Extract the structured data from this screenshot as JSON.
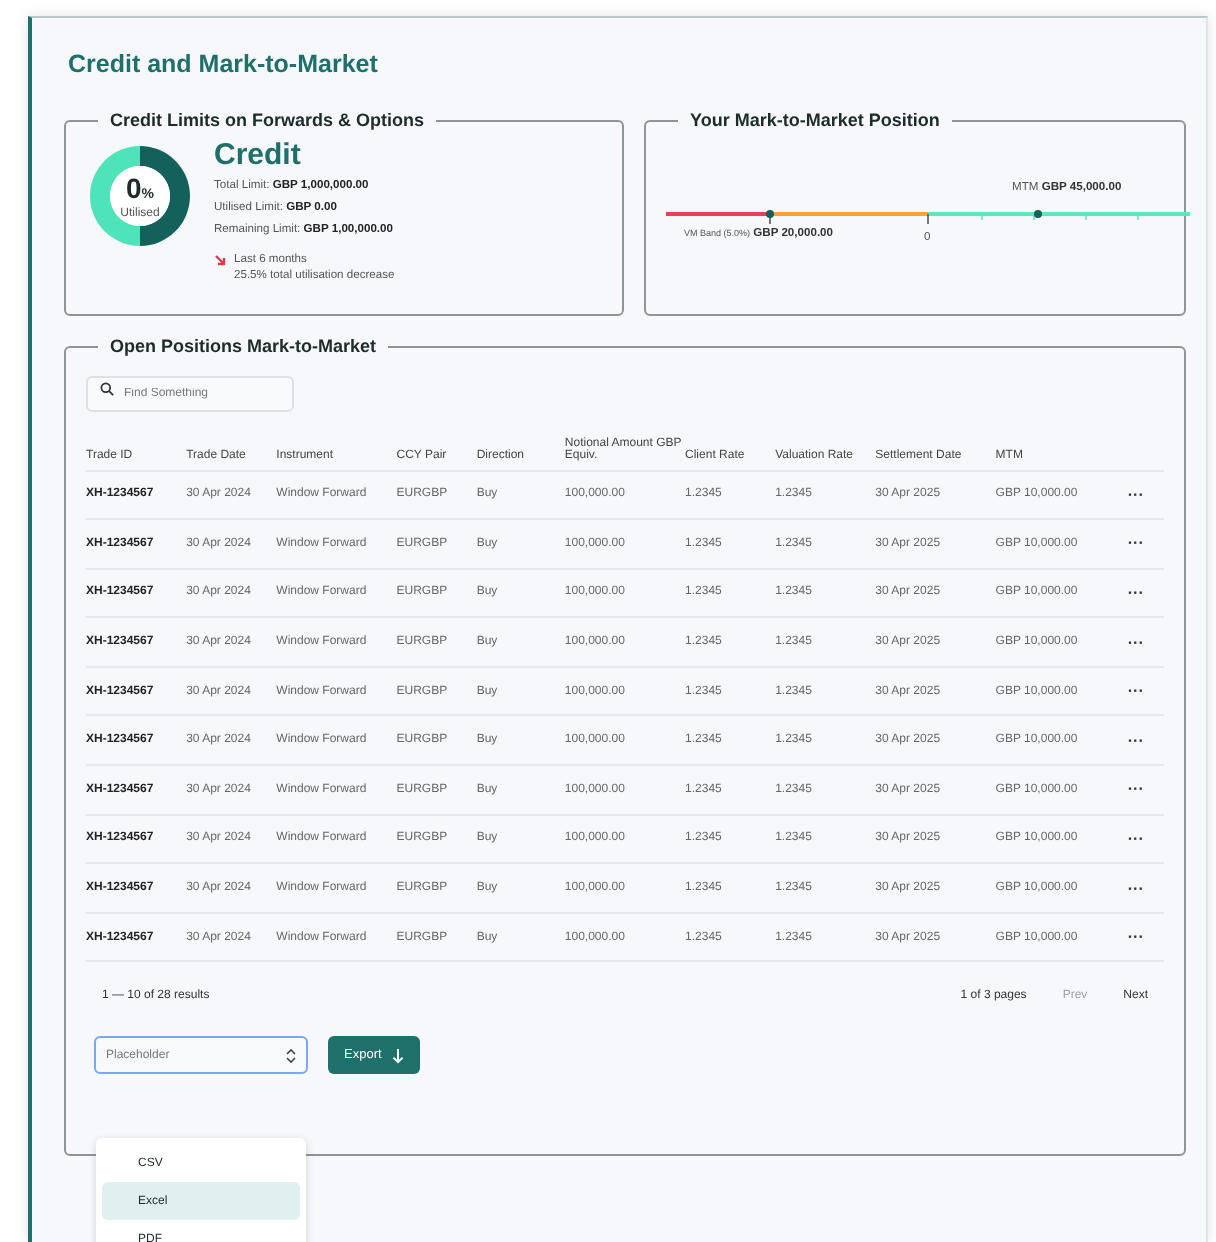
{
  "page_title": "Credit and Mark-to-Market",
  "credit_limits": {
    "legend": "Credit Limits on Forwards & Options",
    "percent": "0",
    "percent_unit": "%",
    "utilised_label": "Utilised",
    "heading": "Credit",
    "lines": [
      {
        "label": "Total Limit:",
        "value": "GBP 1,000,000.00"
      },
      {
        "label": "Utilised Limit:",
        "value": "GBP 0.00"
      },
      {
        "label": "Remaining Limit:",
        "value": "GBP 1,00,000.00"
      }
    ],
    "trend": {
      "decrease": true,
      "period": "Last 6 months",
      "note": "25.5% total utilisation decrease"
    }
  },
  "mtm_position": {
    "legend": "Your Mark-to-Market Position",
    "mtm_label": "MTM",
    "mtm_value": "GBP 45,000.00",
    "vm_label": "VM Band (5.0%)",
    "vm_value": "GBP 20,000.00",
    "zero_label": "0"
  },
  "positions": {
    "legend": "Open Positions Mark-to-Market",
    "search": {
      "placeholder": "Find Something"
    },
    "columns": [
      "Trade ID",
      "Trade Date",
      "Instrument",
      "CCY Pair",
      "Direction",
      "Notional Amount GBP Equiv.",
      "Client Rate",
      "Valuation Rate",
      "Settlement Date",
      "MTM"
    ],
    "rows": [
      {
        "cells": [
          "XH-1234567",
          "30 Apr 2024",
          "Window Forward",
          "EURGBP",
          "Buy",
          "100,000.00",
          "1.2345",
          "1.2345",
          "30 Apr 2025",
          "GBP 10,000.00"
        ],
        "menu": "···"
      },
      {
        "cells": [
          "XH-1234567",
          "30 Apr 2024",
          "Window Forward",
          "EURGBP",
          "Buy",
          "100,000.00",
          "1.2345",
          "1.2345",
          "30 Apr 2025",
          "GBP 10,000.00"
        ],
        "menu": "···"
      },
      {
        "cells": [
          "XH-1234567",
          "30 Apr 2024",
          "Window Forward",
          "EURGBP",
          "Buy",
          "100,000.00",
          "1.2345",
          "1.2345",
          "30 Apr 2025",
          "GBP 10,000.00"
        ],
        "menu": "···"
      },
      {
        "cells": [
          "XH-1234567",
          "30 Apr 2024",
          "Window Forward",
          "EURGBP",
          "Buy",
          "100,000.00",
          "1.2345",
          "1.2345",
          "30 Apr 2025",
          "GBP 10,000.00"
        ],
        "menu": "···"
      },
      {
        "cells": [
          "XH-1234567",
          "30 Apr 2024",
          "Window Forward",
          "EURGBP",
          "Buy",
          "100,000.00",
          "1.2345",
          "1.2345",
          "30 Apr 2025",
          "GBP 10,000.00"
        ],
        "menu": "···"
      },
      {
        "cells": [
          "XH-1234567",
          "30 Apr 2024",
          "Window Forward",
          "EURGBP",
          "Buy",
          "100,000.00",
          "1.2345",
          "1.2345",
          "30 Apr 2025",
          "GBP 10,000.00"
        ],
        "menu": "···"
      },
      {
        "cells": [
          "XH-1234567",
          "30 Apr 2024",
          "Window Forward",
          "EURGBP",
          "Buy",
          "100,000.00",
          "1.2345",
          "1.2345",
          "30 Apr 2025",
          "GBP 10,000.00"
        ],
        "menu": "···"
      },
      {
        "cells": [
          "XH-1234567",
          "30 Apr 2024",
          "Window Forward",
          "EURGBP",
          "Buy",
          "100,000.00",
          "1.2345",
          "1.2345",
          "30 Apr 2025",
          "GBP 10,000.00"
        ],
        "menu": "···"
      },
      {
        "cells": [
          "XH-1234567",
          "30 Apr 2024",
          "Window Forward",
          "EURGBP",
          "Buy",
          "100,000.00",
          "1.2345",
          "1.2345",
          "30 Apr 2025",
          "GBP 10,000.00"
        ],
        "menu": "···"
      },
      {
        "cells": [
          "XH-1234567",
          "30 Apr 2024",
          "Window Forward",
          "EURGBP",
          "Buy",
          "100,000.00",
          "1.2345",
          "1.2345",
          "30 Apr 2025",
          "GBP 10,000.00"
        ],
        "menu": "···"
      }
    ],
    "results": "1 — 10 of 28 results",
    "pages": "1 of 3 pages",
    "pager": [
      {
        "label": "Prev",
        "disabled": true
      },
      {
        "label": "Next",
        "disabled": false
      }
    ],
    "export_select": {
      "placeholder": "Placeholder",
      "expanded": true,
      "options": [
        {
          "label": "CSV",
          "selected": false
        },
        {
          "label": "Excel",
          "selected": true
        },
        {
          "label": "PDF",
          "selected": false
        }
      ]
    },
    "export_button": "Export"
  }
}
